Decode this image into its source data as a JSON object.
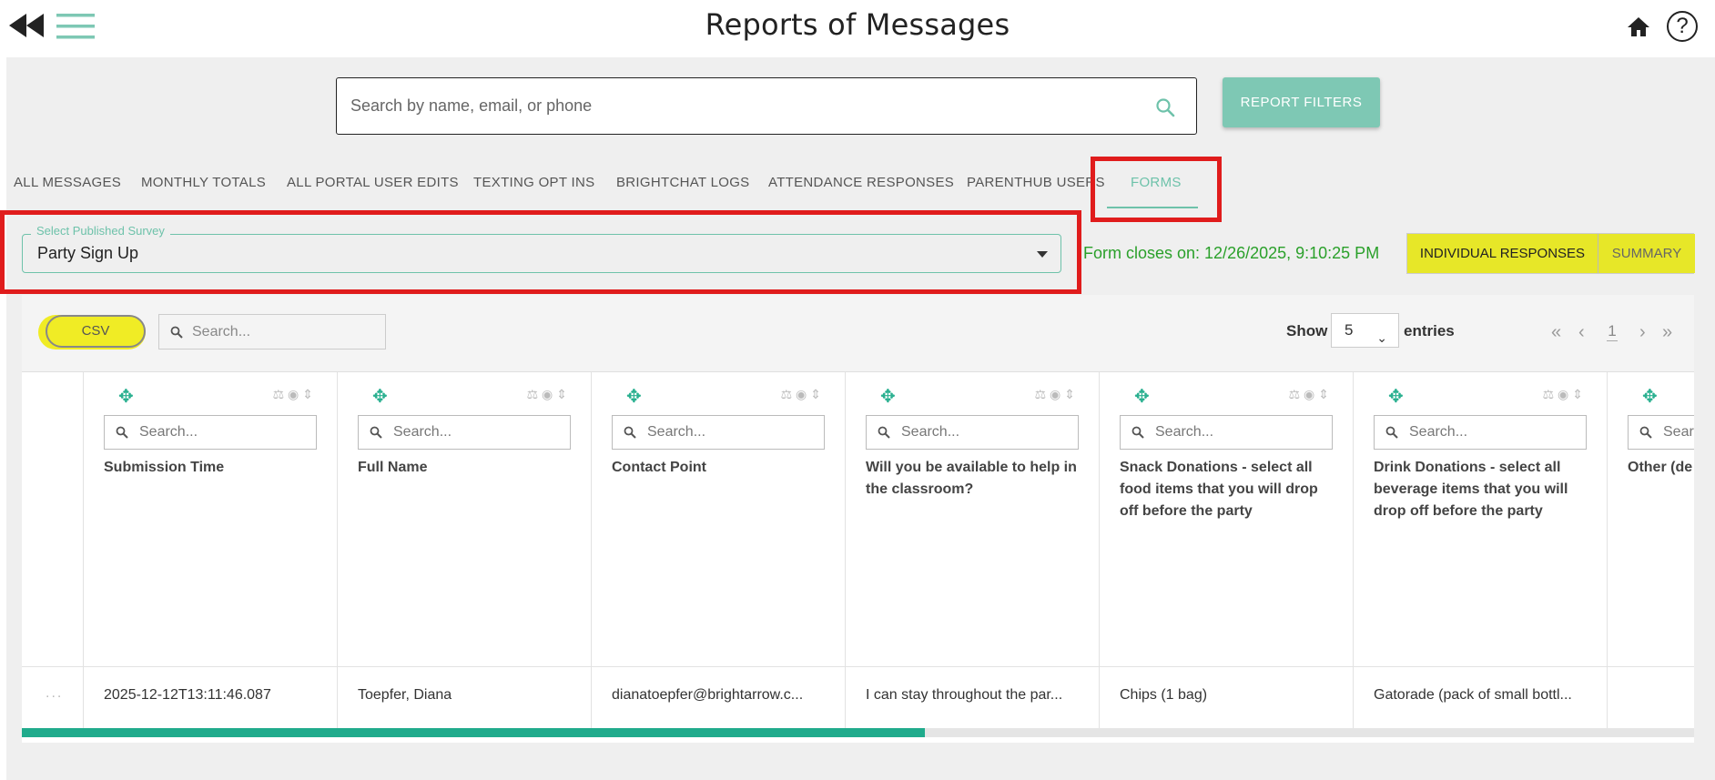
{
  "header": {
    "title": "Reports of Messages",
    "help_glyph": "?"
  },
  "search": {
    "placeholder": "Search by name, email, or phone"
  },
  "report_filters_label": "REPORT FILTERS",
  "tabs": [
    {
      "label": "ALL MESSAGES"
    },
    {
      "label": "MONTHLY TOTALS"
    },
    {
      "label": "ALL PORTAL USER EDITS"
    },
    {
      "label": "TEXTING OPT INS"
    },
    {
      "label": "BRIGHTCHAT LOGS"
    },
    {
      "label": "ATTENDANCE RESPONSES"
    },
    {
      "label": "PARENTHUB USERS"
    },
    {
      "label": "FORMS",
      "active": true
    }
  ],
  "survey": {
    "legend": "Select Published Survey",
    "value": "Party Sign Up"
  },
  "form_closes": "Form closes on: 12/26/2025, 9:10:25 PM",
  "view_toggle": {
    "individual": "INDIVIDUAL RESPONSES",
    "summary": "SUMMARY"
  },
  "table": {
    "csv_label": "CSV",
    "search_placeholder": "Search...",
    "show_label": "Show",
    "page_size": "5",
    "entries_label": "entries",
    "current_page": "1",
    "columns": [
      {
        "title": "Submission Time"
      },
      {
        "title": "Full Name"
      },
      {
        "title": "Contact Point"
      },
      {
        "title": "Will you be available to help in the classroom?"
      },
      {
        "title": "Snack Donations - select all food items that you will drop off before the party"
      },
      {
        "title": "Drink Donations - select all beverage items that you will drop off before the party"
      },
      {
        "title": "Other (de"
      }
    ],
    "column_search_placeholder": "Search...",
    "last_column_search_placeholder": "Sear",
    "rows": [
      {
        "more": "...",
        "cells": [
          "2025-12-12T13:11:46.087",
          "Toepfer, Diana",
          "dianatoepfer@brightarrow.c...",
          "I can stay throughout the par...",
          "Chips (1 bag)",
          "Gatorade (pack of small bottl...",
          ""
        ]
      }
    ],
    "scroll_fraction": 0.54
  },
  "colors": {
    "accent": "#6ec2aa",
    "button_teal": "#7ec8b4",
    "highlight_yellow": "#e7e728",
    "annotation_red": "#e01c1c",
    "form_closes_green": "#2aa02a",
    "scroll_thumb": "#20ab8c"
  },
  "icons": [
    "rewind-icon",
    "hamburger-menu-icon",
    "home-icon",
    "help-icon",
    "search-icon",
    "move-icon",
    "filter-icon",
    "hide-icon",
    "sort-icon",
    "chevron-down-icon",
    "first-page-icon",
    "previous-page-icon",
    "next-page-icon",
    "last-page-icon"
  ]
}
